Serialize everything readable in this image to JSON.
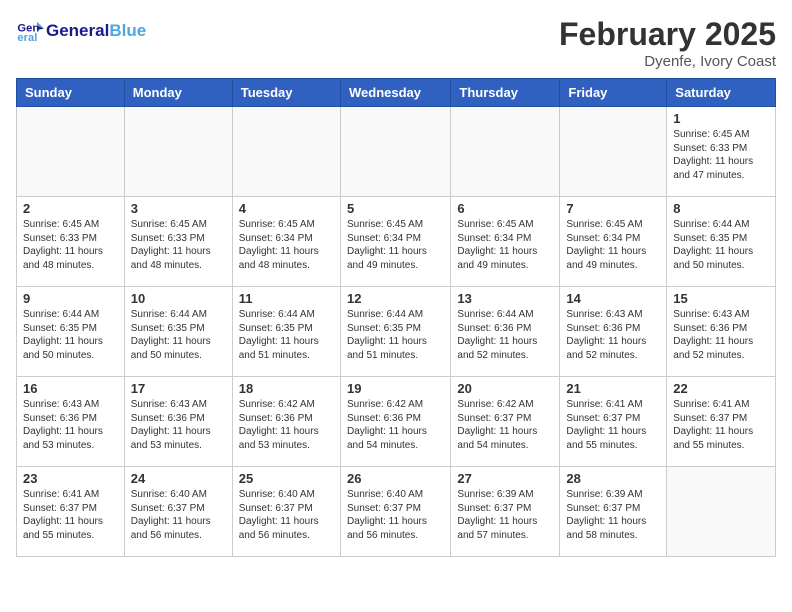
{
  "logo": {
    "text_general": "General",
    "text_blue": "Blue"
  },
  "header": {
    "title": "February 2025",
    "subtitle": "Dyenfe, Ivory Coast"
  },
  "weekdays": [
    "Sunday",
    "Monday",
    "Tuesday",
    "Wednesday",
    "Thursday",
    "Friday",
    "Saturday"
  ],
  "weeks": [
    [
      {
        "num": "",
        "empty": true
      },
      {
        "num": "",
        "empty": true
      },
      {
        "num": "",
        "empty": true
      },
      {
        "num": "",
        "empty": true
      },
      {
        "num": "",
        "empty": true
      },
      {
        "num": "",
        "empty": true
      },
      {
        "num": "1",
        "sunrise": "6:45 AM",
        "sunset": "6:33 PM",
        "daylight": "11 hours and 47 minutes."
      }
    ],
    [
      {
        "num": "2",
        "sunrise": "6:45 AM",
        "sunset": "6:33 PM",
        "daylight": "11 hours and 48 minutes."
      },
      {
        "num": "3",
        "sunrise": "6:45 AM",
        "sunset": "6:33 PM",
        "daylight": "11 hours and 48 minutes."
      },
      {
        "num": "4",
        "sunrise": "6:45 AM",
        "sunset": "6:34 PM",
        "daylight": "11 hours and 48 minutes."
      },
      {
        "num": "5",
        "sunrise": "6:45 AM",
        "sunset": "6:34 PM",
        "daylight": "11 hours and 49 minutes."
      },
      {
        "num": "6",
        "sunrise": "6:45 AM",
        "sunset": "6:34 PM",
        "daylight": "11 hours and 49 minutes."
      },
      {
        "num": "7",
        "sunrise": "6:45 AM",
        "sunset": "6:34 PM",
        "daylight": "11 hours and 49 minutes."
      },
      {
        "num": "8",
        "sunrise": "6:44 AM",
        "sunset": "6:35 PM",
        "daylight": "11 hours and 50 minutes."
      }
    ],
    [
      {
        "num": "9",
        "sunrise": "6:44 AM",
        "sunset": "6:35 PM",
        "daylight": "11 hours and 50 minutes."
      },
      {
        "num": "10",
        "sunrise": "6:44 AM",
        "sunset": "6:35 PM",
        "daylight": "11 hours and 50 minutes."
      },
      {
        "num": "11",
        "sunrise": "6:44 AM",
        "sunset": "6:35 PM",
        "daylight": "11 hours and 51 minutes."
      },
      {
        "num": "12",
        "sunrise": "6:44 AM",
        "sunset": "6:35 PM",
        "daylight": "11 hours and 51 minutes."
      },
      {
        "num": "13",
        "sunrise": "6:44 AM",
        "sunset": "6:36 PM",
        "daylight": "11 hours and 52 minutes."
      },
      {
        "num": "14",
        "sunrise": "6:43 AM",
        "sunset": "6:36 PM",
        "daylight": "11 hours and 52 minutes."
      },
      {
        "num": "15",
        "sunrise": "6:43 AM",
        "sunset": "6:36 PM",
        "daylight": "11 hours and 52 minutes."
      }
    ],
    [
      {
        "num": "16",
        "sunrise": "6:43 AM",
        "sunset": "6:36 PM",
        "daylight": "11 hours and 53 minutes."
      },
      {
        "num": "17",
        "sunrise": "6:43 AM",
        "sunset": "6:36 PM",
        "daylight": "11 hours and 53 minutes."
      },
      {
        "num": "18",
        "sunrise": "6:42 AM",
        "sunset": "6:36 PM",
        "daylight": "11 hours and 53 minutes."
      },
      {
        "num": "19",
        "sunrise": "6:42 AM",
        "sunset": "6:36 PM",
        "daylight": "11 hours and 54 minutes."
      },
      {
        "num": "20",
        "sunrise": "6:42 AM",
        "sunset": "6:37 PM",
        "daylight": "11 hours and 54 minutes."
      },
      {
        "num": "21",
        "sunrise": "6:41 AM",
        "sunset": "6:37 PM",
        "daylight": "11 hours and 55 minutes."
      },
      {
        "num": "22",
        "sunrise": "6:41 AM",
        "sunset": "6:37 PM",
        "daylight": "11 hours and 55 minutes."
      }
    ],
    [
      {
        "num": "23",
        "sunrise": "6:41 AM",
        "sunset": "6:37 PM",
        "daylight": "11 hours and 55 minutes."
      },
      {
        "num": "24",
        "sunrise": "6:40 AM",
        "sunset": "6:37 PM",
        "daylight": "11 hours and 56 minutes."
      },
      {
        "num": "25",
        "sunrise": "6:40 AM",
        "sunset": "6:37 PM",
        "daylight": "11 hours and 56 minutes."
      },
      {
        "num": "26",
        "sunrise": "6:40 AM",
        "sunset": "6:37 PM",
        "daylight": "11 hours and 56 minutes."
      },
      {
        "num": "27",
        "sunrise": "6:39 AM",
        "sunset": "6:37 PM",
        "daylight": "11 hours and 57 minutes."
      },
      {
        "num": "28",
        "sunrise": "6:39 AM",
        "sunset": "6:37 PM",
        "daylight": "11 hours and 58 minutes."
      },
      {
        "num": "",
        "empty": true
      }
    ]
  ]
}
